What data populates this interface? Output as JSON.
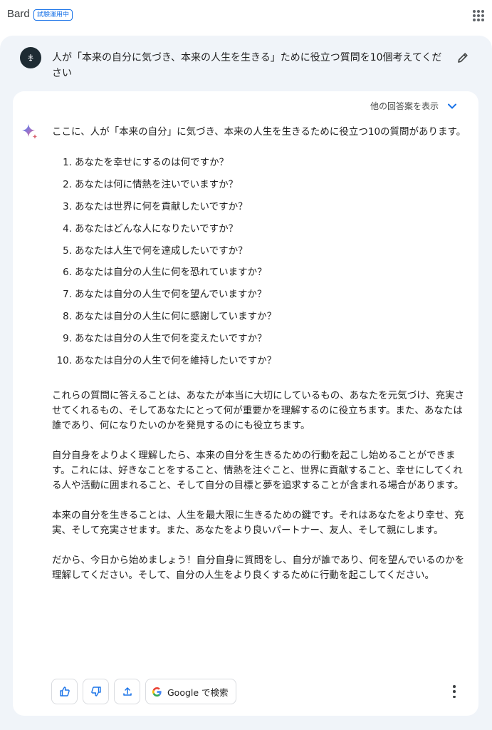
{
  "app": {
    "name": "Bard",
    "badge": "試験運用中",
    "apps_icon": "apps-grid-icon"
  },
  "conversation": {
    "user_prompt": "人が「本来の自分に気づき、本来の人生を生きる」ために役立つ質問を10個考えてください",
    "edit_icon": "pencil-icon",
    "response": {
      "drafts_label": "他の回答案を表示",
      "intro": "ここに、人が「本来の自分」に気づき、本来の人生を生きるために役立つ10の質問があります。",
      "questions": [
        {
          "num": "1.",
          "text": "あなたを幸せにするのは何ですか？"
        },
        {
          "num": "2.",
          "text": "あなたは何に情熱を注いでいますか？"
        },
        {
          "num": "3.",
          "text": "あなたは世界に何を貢献したいですか？"
        },
        {
          "num": "4.",
          "text": "あなたはどんな人になりたいですか？"
        },
        {
          "num": "5.",
          "text": "あなたは人生で何を達成したいですか？"
        },
        {
          "num": "6.",
          "text": "あなたは自分の人生に何を恐れていますか？"
        },
        {
          "num": "7.",
          "text": "あなたは自分の人生で何を望んでいますか？"
        },
        {
          "num": "8.",
          "text": "あなたは自分の人生に何に感謝していますか？"
        },
        {
          "num": "9.",
          "text": "あなたは自分の人生で何を変えたいですか？"
        },
        {
          "num": "10.",
          "text": "あなたは自分の人生で何を維持したいですか？"
        }
      ],
      "paragraphs": [
        "これらの質問に答えることは、あなたが本当に大切にしているもの、あなたを元気づけ、充実させてくれるもの、そしてあなたにとって何が重要かを理解するのに役立ちます。また、あなたは誰であり、何になりたいのかを発見するのにも役立ちます。",
        "自分自身をよりよく理解したら、本来の自分を生きるための行動を起こし始めることができます。これには、好きなことをすること、情熱を注ぐこと、世界に貢献すること、幸せにしてくれる人や活動に囲まれること、そして自分の目標と夢を追求することが含まれる場合があります。",
        "本来の自分を生きることは、人生を最大限に生きるための鍵です。それはあなたをより幸せ、充実、そして充実させます。また、あなたをより良いパートナー、友人、そして親にします。",
        "だから、今日から始めましょう！自分自身に質問をし、自分が誰であり、何を望んでいるのかを理解してください。そして、自分の人生をより良くするために行動を起こしてください。"
      ],
      "actions": {
        "google_search_label": "Google で検索",
        "icons": [
          "thumb-up-icon",
          "thumb-down-icon",
          "share-icon",
          "google-g-icon",
          "more-vert-icon"
        ]
      }
    }
  },
  "colors": {
    "accent": "#1a73e8",
    "panel_bg": "#f0f4f9",
    "card_bg": "#ffffff"
  }
}
